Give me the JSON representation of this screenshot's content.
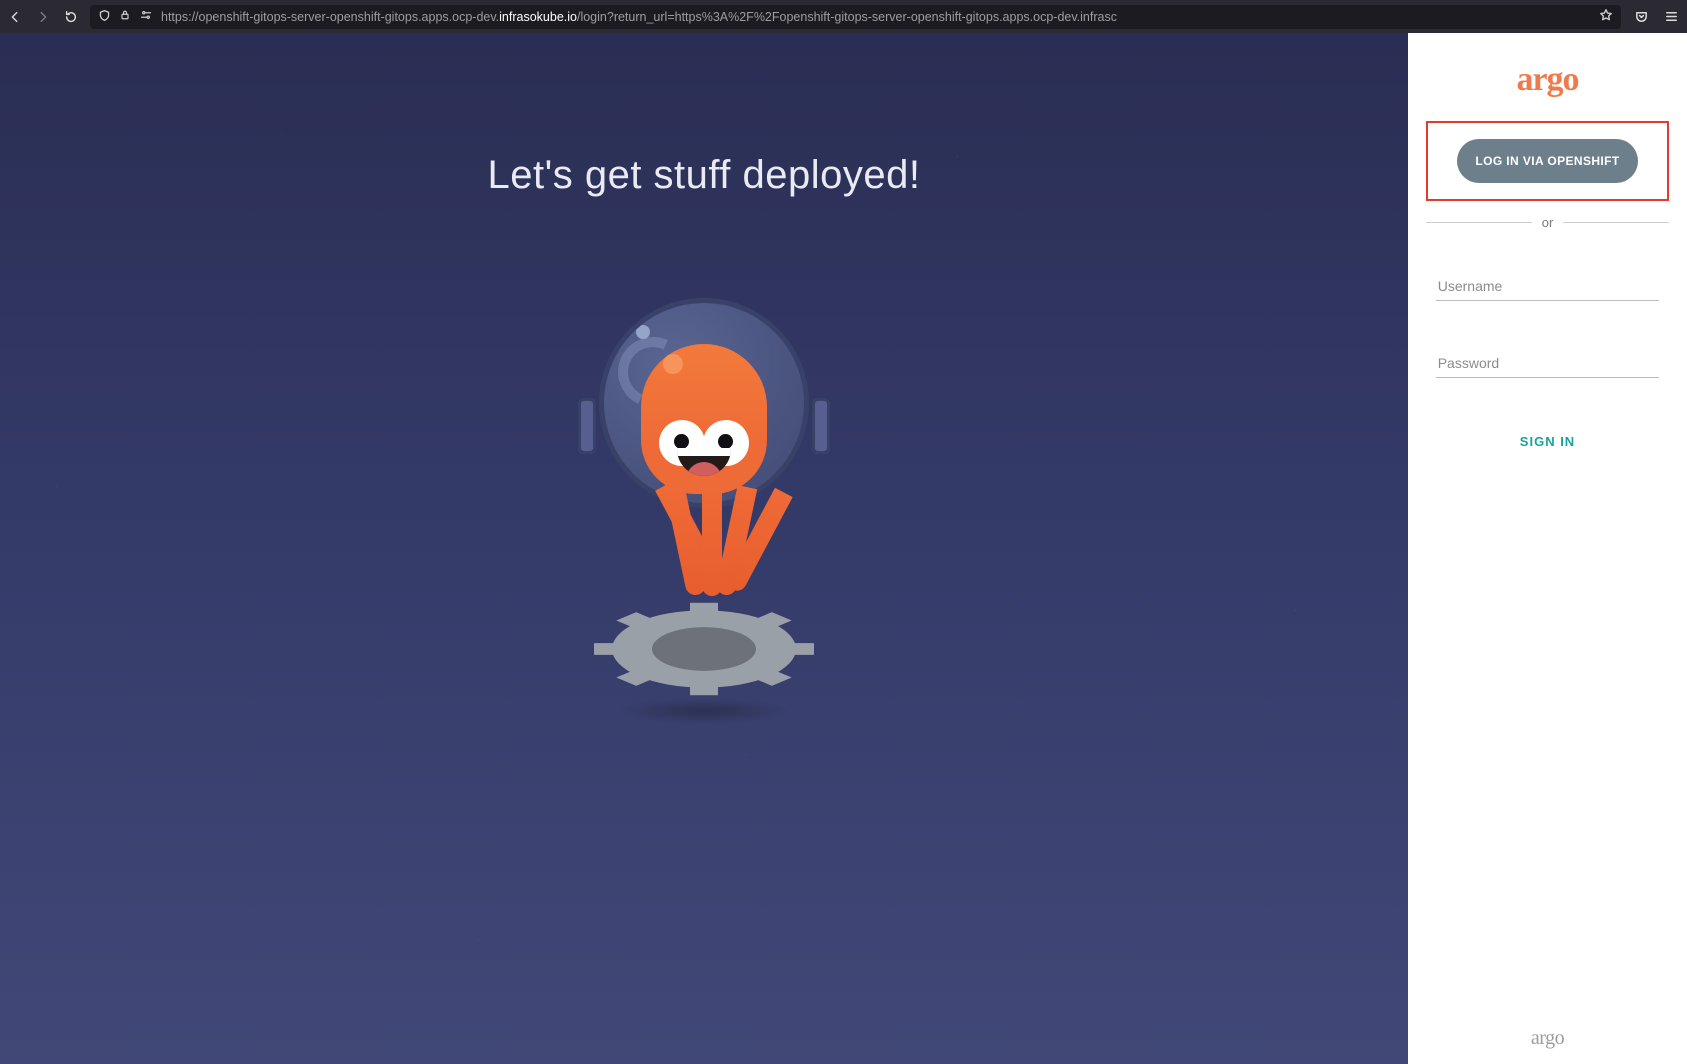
{
  "browser": {
    "url_prefix": "https://openshift-gitops-server-openshift-gitops.apps.ocp-dev.",
    "url_domain": "infrasokube.io",
    "url_suffix": "/login?return_url=https%3A%2F%2Fopenshift-gitops-server-openshift-gitops.apps.ocp-dev.infrasc"
  },
  "hero": {
    "headline": "Let's get stuff deployed!"
  },
  "login": {
    "brand": "argo",
    "sso_button": "LOG IN VIA OPENSHIFT",
    "divider": "or",
    "username_placeholder": "Username",
    "password_placeholder": "Password",
    "signin": "SIGN IN",
    "footer_brand": "argo"
  }
}
